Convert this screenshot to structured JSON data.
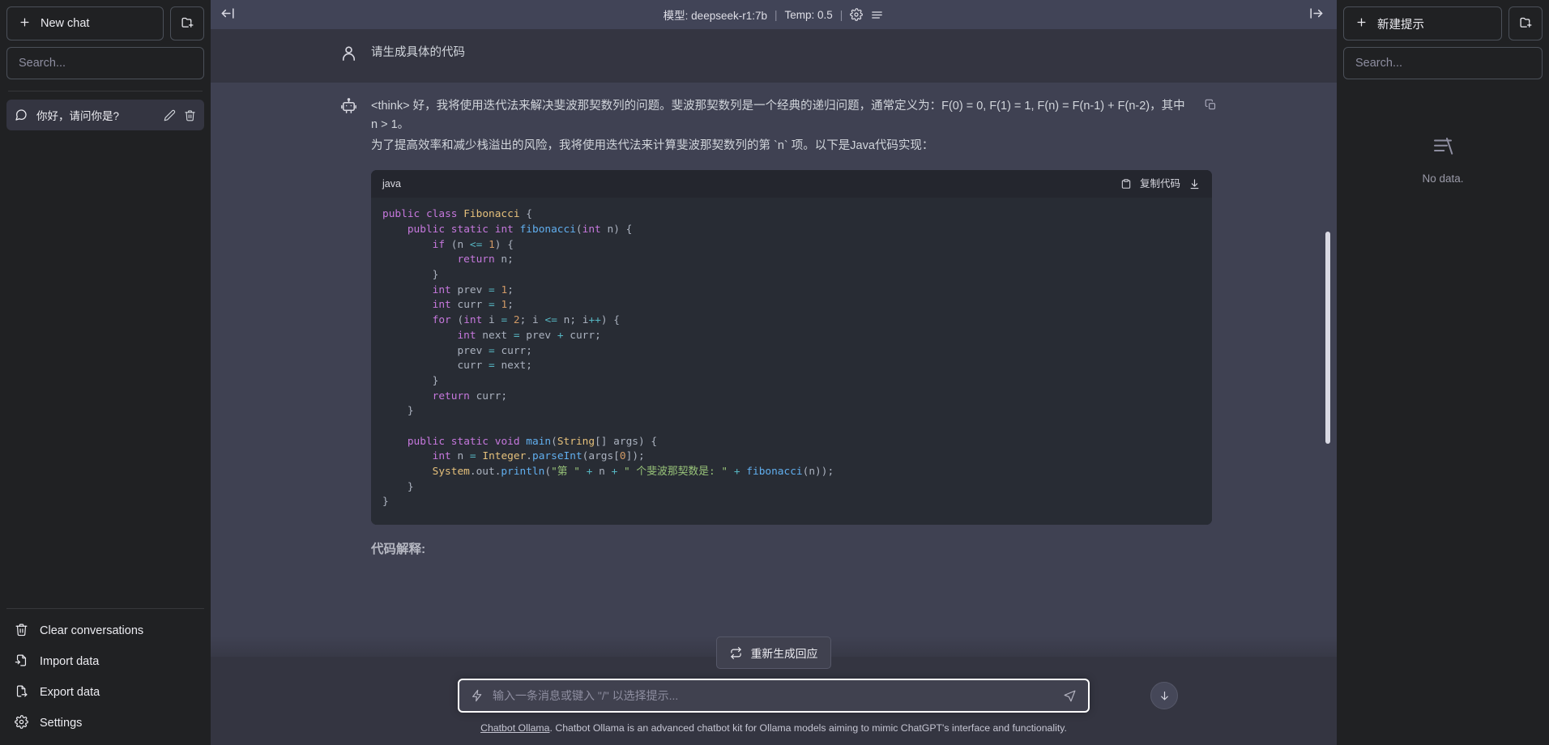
{
  "left_sidebar": {
    "new_chat_label": "New chat",
    "new_folder_icon": "new-folder-icon",
    "search_placeholder": "Search...",
    "conversations": [
      {
        "title": "你好，请问你是?",
        "icon": "chat-bubble-icon",
        "edit_icon": "pencil-icon",
        "delete_icon": "trash-icon"
      }
    ],
    "bottom_items": [
      {
        "label": "Clear conversations",
        "icon": "trash-icon"
      },
      {
        "label": "Import data",
        "icon": "import-icon"
      },
      {
        "label": "Export data",
        "icon": "export-icon"
      },
      {
        "label": "Settings",
        "icon": "gear-icon"
      }
    ]
  },
  "topbar": {
    "collapse_left_icon": "arrow-left-to-line-icon",
    "collapse_right_icon": "arrow-right-to-line-icon",
    "model_label": "模型: deepseek-r1:7b",
    "separator": "|",
    "temp_label": "Temp: 0.5",
    "settings_icon": "gear-icon",
    "menu_icon": "list-icon"
  },
  "chat": {
    "messages": [
      {
        "role": "user",
        "avatar_icon": "user-icon",
        "text": "请生成具体的代码"
      },
      {
        "role": "assistant",
        "avatar_icon": "robot-icon",
        "copy_icon": "copy-icon",
        "paragraphs": [
          "<think> 好，我将使用迭代法来解决斐波那契数列的问题。斐波那契数列是一个经典的递归问题，通常定义为：F(0) = 0, F(1) = 1, F(n) = F(n-1) + F(n-2)，其中 n > 1。",
          "为了提高效率和减少栈溢出的风险，我将使用迭代法来计算斐波那契数列的第 `n` 项。以下是Java代码实现："
        ],
        "code_block": {
          "language": "java",
          "copy_label": "复制代码",
          "copy_icon": "clipboard-icon",
          "download_icon": "download-icon",
          "code": "public class Fibonacci {\n    public static int fibonacci(int n) {\n        if (n <= 1) {\n            return n;\n        }\n        int prev = 1;\n        int curr = 1;\n        for (int i = 2; i <= n; i++) {\n            int next = prev + curr;\n            prev = curr;\n            curr = next;\n        }\n        return curr;\n    }\n\n    public static void main(String[] args) {\n        int n = Integer.parseInt(args[0]);\n        System.out.println(\"第 \" + n + \" 个斐波那契数是: \" + fibonacci(n));\n    }\n}"
        },
        "after_code_text": "代码解释:"
      }
    ]
  },
  "composer": {
    "regenerate_label": "重新生成回应",
    "regenerate_icon": "refresh-icon",
    "prompt_icon": "bolt-icon",
    "input_value": "",
    "input_placeholder": "输入一条消息或键入 \"/\" 以选择提示...",
    "send_icon": "send-icon",
    "scroll_down_icon": "arrow-down-icon"
  },
  "footer": {
    "link_text": "Chatbot Ollama",
    "text": ". Chatbot Ollama is an advanced chatbot kit for Ollama models aiming to mimic ChatGPT's interface and functionality."
  },
  "right_sidebar": {
    "new_prompt_label": "新建提示",
    "new_folder_icon": "new-folder-icon",
    "search_placeholder": "Search...",
    "empty_icon": "no-data-icon",
    "empty_label": "No data."
  },
  "colors": {
    "sidebar_bg": "#202123",
    "main_bg": "#343541",
    "assistant_bg": "#3f4152",
    "topbar_bg": "#414457",
    "code_bg": "#282c34",
    "code_head_bg": "#24262e"
  }
}
